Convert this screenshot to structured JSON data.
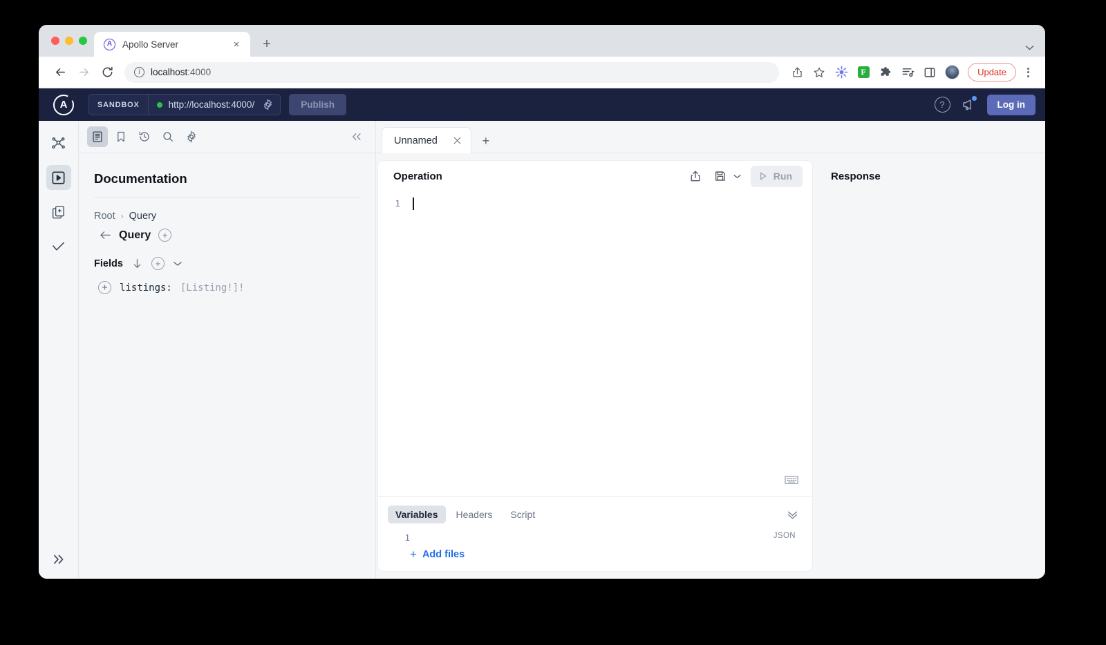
{
  "browser": {
    "tab": {
      "title": "Apollo Server",
      "favicon_letter": "A",
      "close_label": "×"
    },
    "new_tab_label": "+",
    "tabstrip_chevron": "⌄",
    "address": {
      "host": "localhost",
      "port": ":4000"
    },
    "update_button": "Update",
    "icons": {
      "back": "back-arrow-icon",
      "forward": "forward-arrow-icon",
      "reload": "reload-icon",
      "info": "site-info-icon",
      "share": "share-icon",
      "bookmark": "star-icon",
      "ext_grape": "grapes-extension-icon",
      "ext_f": "F",
      "ext_puzzle": "puzzle-extension-icon",
      "ext_list": "reading-list-icon",
      "ext_panel": "side-panel-icon",
      "avatar": "profile-avatar"
    }
  },
  "app_header": {
    "logo_letter": "A",
    "sandbox_badge": "SANDBOX",
    "endpoint_url": "http://localhost:4000/",
    "publish_label": "Publish",
    "login_label": "Log in",
    "help_label": "?",
    "status_color": "#2fbf4c",
    "bg_color": "#1b2240",
    "login_color": "#5c6bb8"
  },
  "left_rail": {
    "items": [
      {
        "name": "schema-graph-icon"
      },
      {
        "name": "explorer-icon",
        "active": true
      },
      {
        "name": "schema-diff-icon"
      },
      {
        "name": "checks-icon"
      }
    ],
    "expand_label": "expand-rail"
  },
  "docs": {
    "toolbar": [
      {
        "name": "documentation-icon",
        "active": true
      },
      {
        "name": "bookmark-icon",
        "active": false
      },
      {
        "name": "history-icon",
        "active": false
      },
      {
        "name": "search-icon",
        "active": false
      },
      {
        "name": "settings-icon",
        "active": false
      }
    ],
    "collapse_label": "«",
    "title": "Documentation",
    "breadcrumb": {
      "root": "Root",
      "separator": "›",
      "current": "Query"
    },
    "type_name": "Query",
    "fields_label": "Fields",
    "fields": [
      {
        "name": "listings:",
        "type": "[Listing!]!"
      }
    ]
  },
  "operation": {
    "tabs": [
      {
        "label": "Unnamed",
        "close": "×",
        "active": true
      }
    ],
    "add_tab_label": "+",
    "panel_title": "Operation",
    "run_label": "Run",
    "editor": {
      "line_number": "1",
      "content": ""
    },
    "actions": {
      "share": "share-operation-icon",
      "save": "save-operation-icon",
      "save_chevron": "⌄"
    },
    "keyboard_icon": "keyboard-shortcuts-icon"
  },
  "variables": {
    "tabs": [
      {
        "label": "Variables",
        "active": true
      },
      {
        "label": "Headers",
        "active": false
      },
      {
        "label": "Script",
        "active": false
      }
    ],
    "collapse_label": "collapse-icon",
    "line_number": "1",
    "format_label": "JSON",
    "add_files_label": "Add files",
    "add_files_plus": "+",
    "link_color": "#1f6feb"
  },
  "response": {
    "title": "Response"
  }
}
